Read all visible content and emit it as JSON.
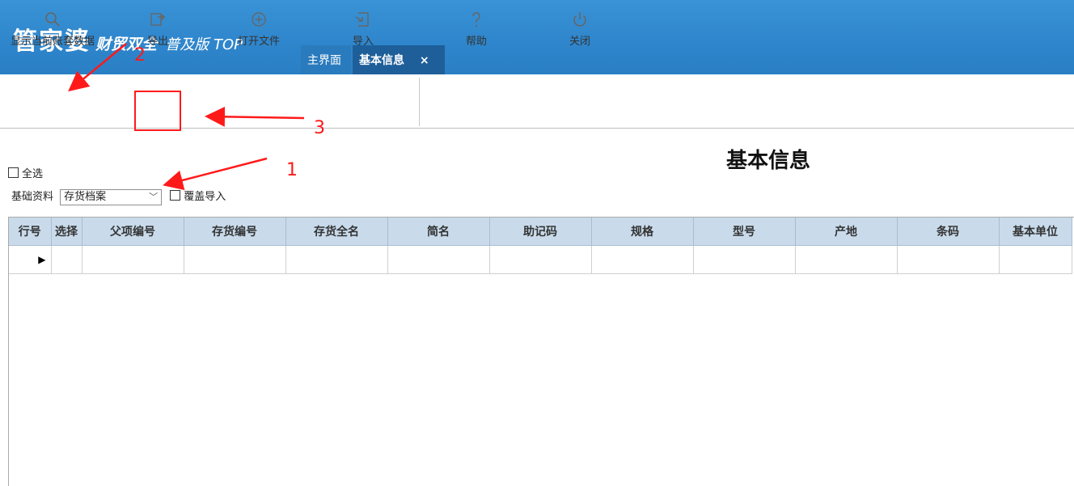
{
  "header": {
    "brand_main": "管家婆",
    "brand_sub": "财贸双全",
    "brand_edition": "普及版 TOP",
    "tabs": [
      {
        "label": "主界面"
      },
      {
        "label": "基本信息",
        "close": "×"
      }
    ]
  },
  "toolbar": {
    "buttons": [
      {
        "label": "显示当前账套数据",
        "icon": "search-icon"
      },
      {
        "label": "导出",
        "icon": "export-icon"
      },
      {
        "label": "打开文件",
        "icon": "plus-circle-icon"
      },
      {
        "label": "导入",
        "icon": "import-icon"
      },
      {
        "label": "帮助",
        "icon": "help-icon"
      },
      {
        "label": "关闭",
        "icon": "power-icon"
      }
    ]
  },
  "page": {
    "title": "基本信息",
    "select_all_label": "全选",
    "basic_data_label": "基础资料",
    "basic_data_value": "存货档案",
    "overwrite_label": "覆盖导入"
  },
  "grid": {
    "columns": [
      "行号",
      "选择",
      "父项编号",
      "存货编号",
      "存货全名",
      "简名",
      "助记码",
      "规格",
      "型号",
      "产地",
      "条码",
      "基本单位"
    ],
    "rows": [
      {
        "row_marker": "▶"
      }
    ]
  },
  "annotations": {
    "labels": [
      "1",
      "2",
      "3"
    ],
    "color": "#ff1a1a"
  },
  "colors": {
    "header_blue": "#2f86cc",
    "active_tab": "#1e5f9a",
    "grid_header": "#c9dbeb"
  }
}
